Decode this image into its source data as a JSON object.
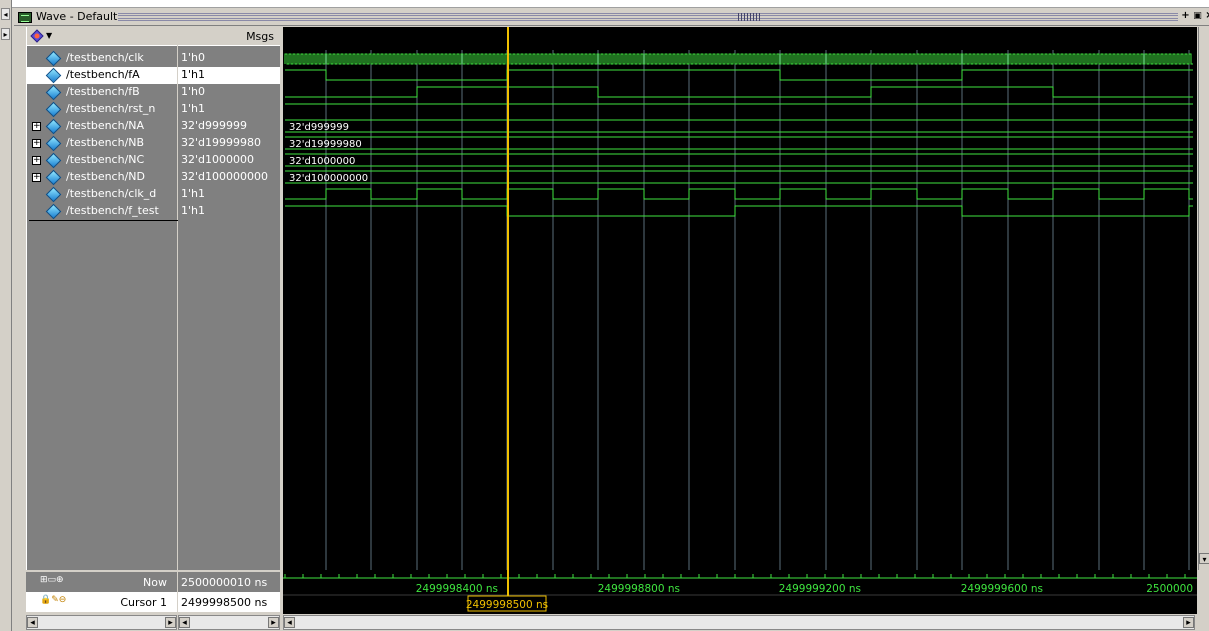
{
  "window": {
    "title": "Wave - Default"
  },
  "header": {
    "msgs_label": "Msgs"
  },
  "signals": [
    {
      "name": "/testbench/clk",
      "value": "1'h0",
      "expandable": false
    },
    {
      "name": "/testbench/fA",
      "value": "1'h1",
      "expandable": false,
      "selected": true
    },
    {
      "name": "/testbench/fB",
      "value": "1'h0",
      "expandable": false
    },
    {
      "name": "/testbench/rst_n",
      "value": "1'h1",
      "expandable": false
    },
    {
      "name": "/testbench/NA",
      "value": "32'd999999",
      "expandable": true
    },
    {
      "name": "/testbench/NB",
      "value": "32'd19999980",
      "expandable": true
    },
    {
      "name": "/testbench/NC",
      "value": "32'd1000000",
      "expandable": true
    },
    {
      "name": "/testbench/ND",
      "value": "32'd100000000",
      "expandable": true
    },
    {
      "name": "/testbench/clk_d",
      "value": "1'h1",
      "expandable": false
    },
    {
      "name": "/testbench/f_test",
      "value": "1'h1",
      "expandable": false
    }
  ],
  "bus_labels": [
    "32'd999999",
    "32'd19999980",
    "32'd1000000",
    "32'd100000000"
  ],
  "cursors": {
    "now_label": "Now",
    "now_value": "2500000010 ns",
    "cursor_label": "Cursor 1",
    "cursor_value": "2499998500 ns",
    "cursor_marker": "2499998500 ns"
  },
  "timeline_labels": [
    "2499998400 ns",
    "2499998800 ns",
    "2499999200 ns",
    "2499999600 ns",
    "2500000"
  ],
  "colors": {
    "wave": "#3fe43f",
    "cursor": "#f0c000",
    "background": "#000000",
    "timeline_text": "#3fe43f"
  }
}
